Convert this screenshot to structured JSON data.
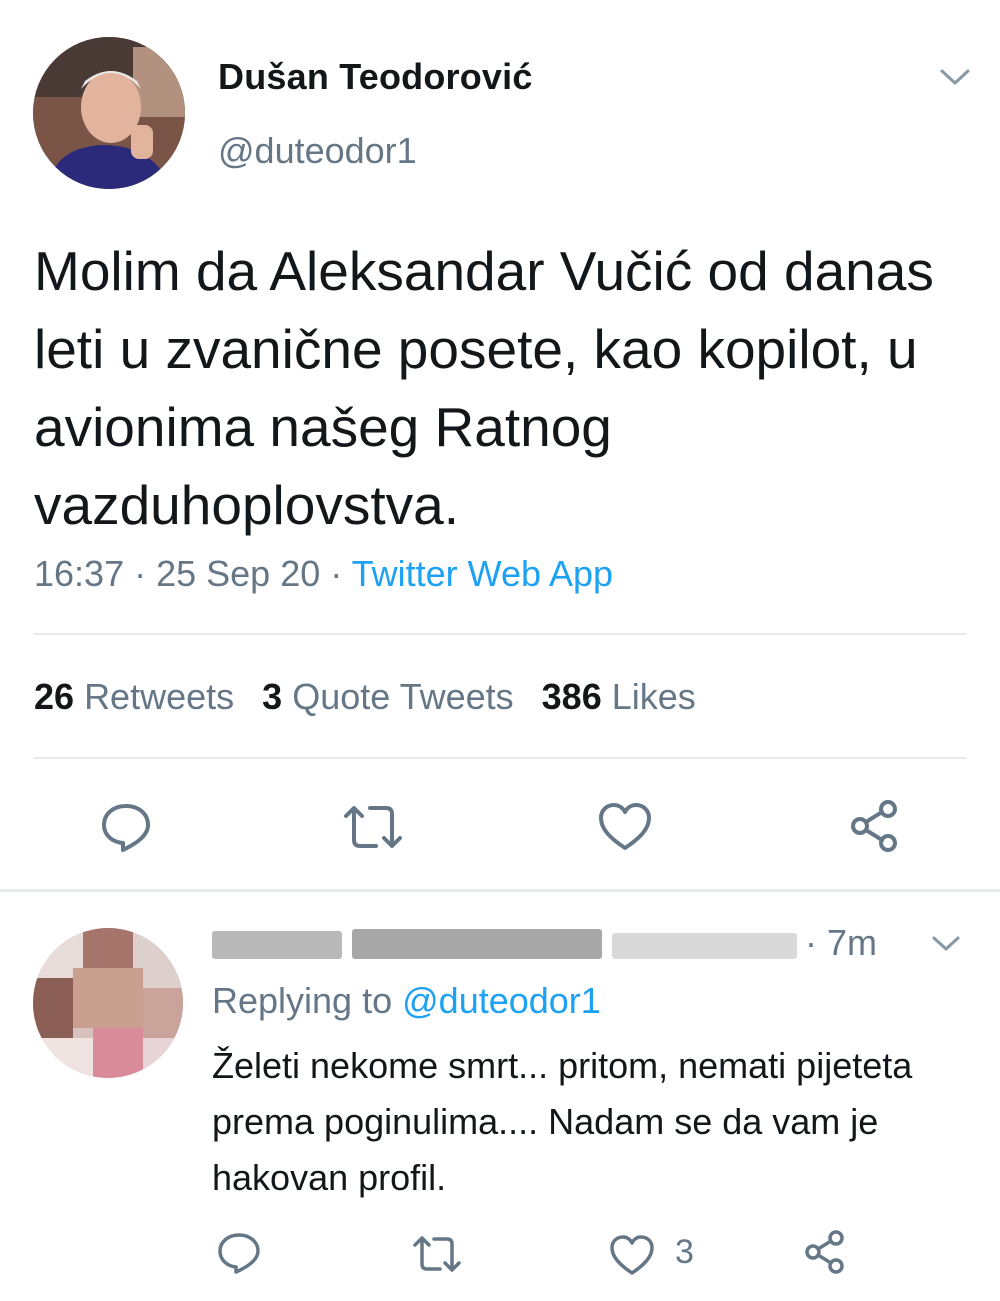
{
  "tweet": {
    "author_name": "Dušan Teodorović",
    "handle": "@duteodor1",
    "text": "Molim da Aleksandar Vučić od danas leti u zvanične posete, kao kopilot, u avionima našeg Ratnog vazduhoplovstva.",
    "time": "16:37",
    "separator": " · ",
    "date": "25 Sep 20",
    "source": "Twitter Web App",
    "stats": {
      "retweets_count": "26",
      "retweets_label": "Retweets",
      "quotes_count": "3",
      "quotes_label": "Quote Tweets",
      "likes_count": "386",
      "likes_label": "Likes"
    },
    "icons": [
      "chevron-down-icon",
      "reply-icon",
      "retweet-icon",
      "like-icon",
      "share-icon"
    ]
  },
  "reply": {
    "time": "· 7m",
    "replying_prefix": "Replying to",
    "replying_mention": "@duteodor1",
    "text": "Želeti nekome smrt... pritom, nemati pijeteta prema poginulima.... Nadam se da vam je hakovan profil.",
    "like_count": "3"
  },
  "colors": {
    "accent": "#1da1f2",
    "secondary_text": "#657786",
    "divider": "#e6ecf0"
  }
}
